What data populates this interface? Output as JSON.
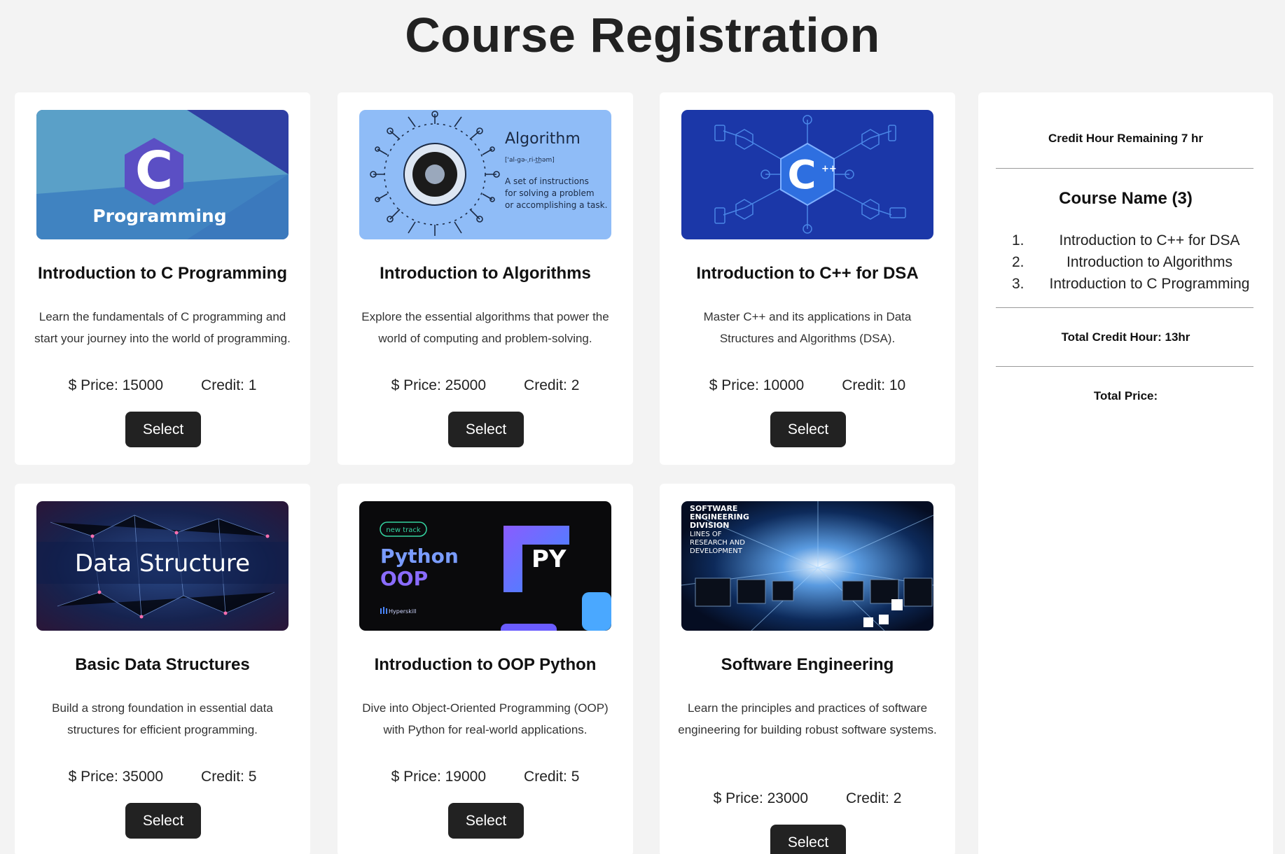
{
  "page": {
    "title": "Course Registration"
  },
  "courses": [
    {
      "title": "Introduction to C Programming",
      "description": "Learn the fundamentals of C programming and start your journey into the world of programming.",
      "price": "$ Price: 15000",
      "credit": "Credit: 1",
      "button": "Select",
      "image": {
        "icon": "c-programming-banner",
        "text": "Programming",
        "logo": "C"
      }
    },
    {
      "title": "Introduction to Algorithms",
      "description": "Explore the essential algorithms that power the world of computing and problem-solving.",
      "price": "$ Price: 25000",
      "credit": "Credit: 2",
      "button": "Select",
      "image": {
        "icon": "algorithm-banner",
        "heading": "Algorithm",
        "pronunciation": "['al-gə-ˌri-t͟həm]",
        "line1": "A set of instructions",
        "line2": "for solving a problem",
        "line3": "or accomplishing a task."
      }
    },
    {
      "title": "Introduction to C++ for DSA",
      "description": "Master C++ and its applications in Data Structures and Algorithms (DSA).",
      "price": "$ Price: 10000",
      "credit": "Credit: 10",
      "button": "Select",
      "image": {
        "icon": "cpp-network-banner",
        "logo": "C",
        "plus": "++"
      }
    },
    {
      "title": "Basic Data Structures",
      "description": "Build a strong foundation in essential data structures for efficient programming.",
      "price": "$ Price: 35000",
      "credit": "Credit: 5",
      "button": "Select",
      "image": {
        "icon": "data-structure-banner",
        "text": "Data Structure"
      }
    },
    {
      "title": "Introduction to OOP Python",
      "description": "Dive into Object-Oriented Programming (OOP) with Python for real-world applications.",
      "price": "$ Price: 19000",
      "credit": "Credit: 5",
      "button": "Select",
      "image": {
        "icon": "python-oop-banner",
        "badge": "new track",
        "line1": "Python",
        "line2": "OOP",
        "logo": "PY",
        "brand": "Hyperskill"
      }
    },
    {
      "title": "Software Engineering",
      "description": "Learn the principles and practices of software engineering for building robust software systems.",
      "price": "$ Price: 23000",
      "credit": "Credit: 2",
      "button": "Select",
      "image": {
        "icon": "software-engineering-banner",
        "l1": "SOFTWARE",
        "l2": "ENGINEERING",
        "l3": "DIVISION",
        "l4": "LINES OF",
        "l5": "RESEARCH AND",
        "l6": "DEVELOPMENT"
      }
    }
  ],
  "sidebar": {
    "credit_remaining": "Credit Hour Remaining 7 hr",
    "course_heading": "Course Name (3)",
    "selected": [
      {
        "num": "1.",
        "name": "Introduction to C++ for DSA"
      },
      {
        "num": "2.",
        "name": "Introduction to Algorithms"
      },
      {
        "num": "3.",
        "name": "Introduction to C Programming"
      }
    ],
    "total_credit": "Total Credit Hour: 13hr",
    "total_price": "Total Price:"
  },
  "colors": {
    "background": "#f3f3f3",
    "card": "#ffffff",
    "button": "#222222",
    "button_text": "#ffffff"
  }
}
